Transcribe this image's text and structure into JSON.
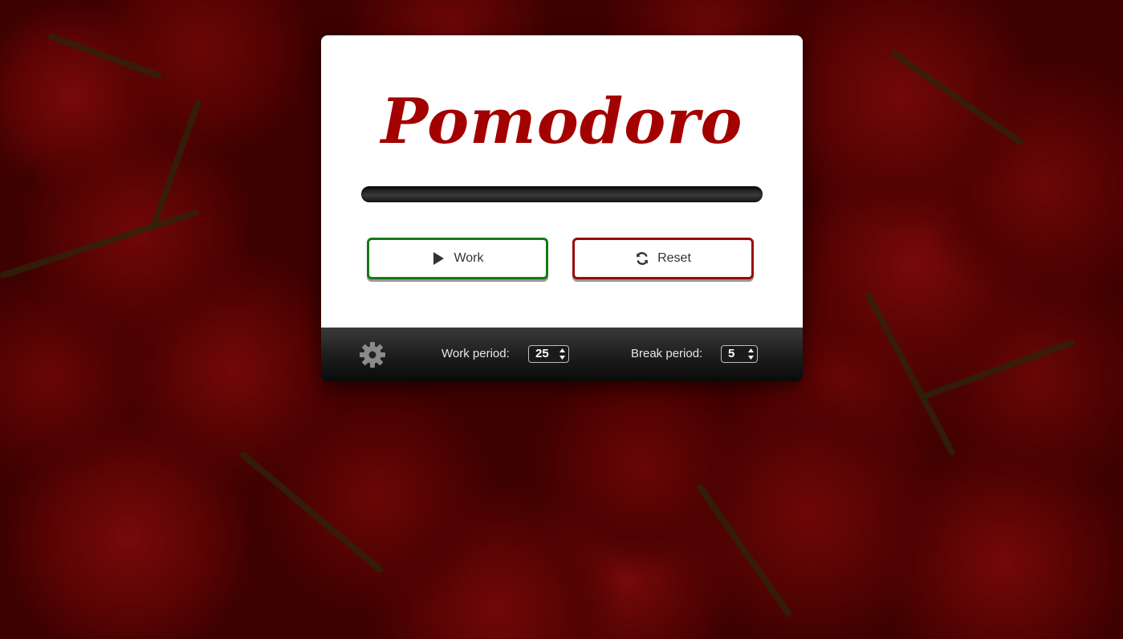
{
  "app": {
    "title": "Pomodoro"
  },
  "progress": {
    "fraction": 0
  },
  "buttons": {
    "work_label": "Work",
    "reset_label": "Reset"
  },
  "icons": {
    "work": "play-icon",
    "reset": "refresh-icon",
    "settings": "gear-icon"
  },
  "settings": {
    "work_period_label": "Work period:",
    "work_period_value": "25",
    "break_period_label": "Break period:",
    "break_period_value": "5"
  },
  "colors": {
    "title": "#a30000",
    "work_border": "#137a13",
    "reset_border": "#960a0a",
    "footer": "#1c1c1c"
  }
}
